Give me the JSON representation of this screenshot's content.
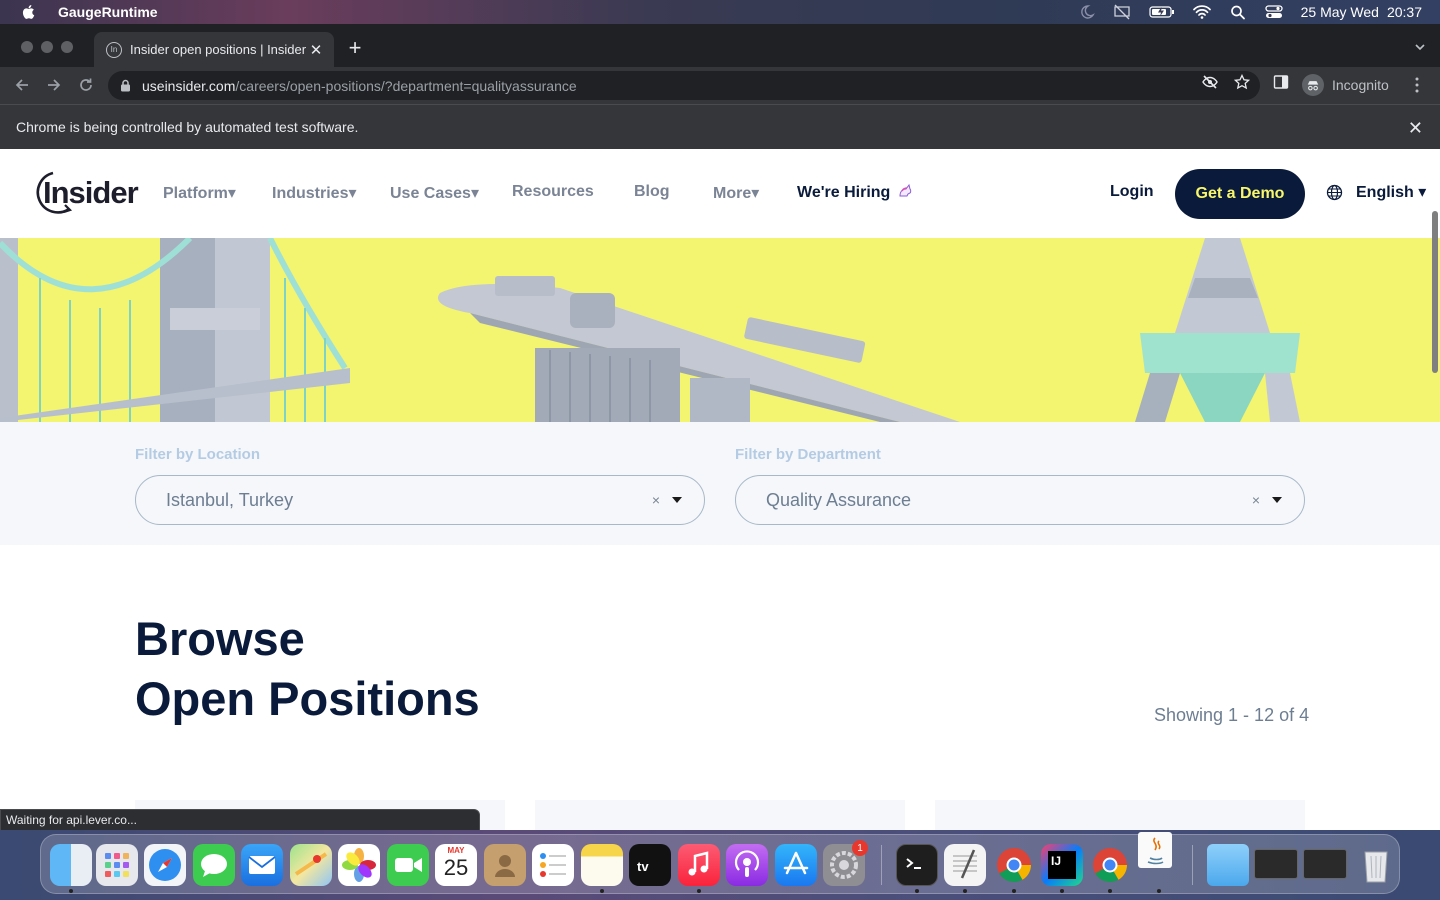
{
  "menubar": {
    "app_name": "GaugeRuntime",
    "date": "25 May Wed",
    "time": "20:37"
  },
  "browser": {
    "tab_title": "Insider open positions | Insider",
    "favicon_letters": "In",
    "url_host": "useinsider.com",
    "url_path": "/careers/open-positions/?department=qualityassurance",
    "profile_label": "Incognito",
    "infobar_message": "Chrome is being controlled by automated test software.",
    "status_text": "Waiting for api.lever.co..."
  },
  "site": {
    "logo_text": "Insider",
    "nav": [
      {
        "label": "Platform▾"
      },
      {
        "label": "Industries▾"
      },
      {
        "label": "Use Cases▾"
      },
      {
        "label": "Resources"
      },
      {
        "label": "Blog"
      },
      {
        "label": "More▾"
      },
      {
        "label": "We're Hiring"
      }
    ],
    "login_label": "Login",
    "demo_label": "Get a Demo",
    "language_label": "English ▾"
  },
  "filters": {
    "location_label": "Filter by Location",
    "location_value": "Istanbul, Turkey",
    "department_label": "Filter by Department",
    "department_value": "Quality Assurance",
    "clear_symbol": "×"
  },
  "listing": {
    "heading_line1": "Browse",
    "heading_line2": "Open Positions",
    "showing_text": "Showing 1 - 12 of 4"
  },
  "dock": {
    "calendar_month": "MAY",
    "calendar_day": "25",
    "settings_badge": "1",
    "apps": [
      "finder-icon",
      "launchpad-icon",
      "safari-icon",
      "messages-icon",
      "mail-icon",
      "maps-icon",
      "photos-icon",
      "facetime-icon",
      "calendar-icon",
      "contacts-icon",
      "reminders-icon",
      "notes-icon",
      "apple-tv-icon",
      "music-icon",
      "podcasts-icon",
      "app-store-icon",
      "system-preferences-icon",
      "terminal-icon",
      "textedit-icon",
      "chrome-icon",
      "intellij-icon",
      "chrome-icon",
      "java-icon",
      "downloads-folder-icon",
      "window-thumbnail-icon",
      "window-thumbnail-icon",
      "trash-icon"
    ]
  },
  "colors": {
    "navy": "#0a1a3a",
    "demo_text": "#f8f66b",
    "hero_yellow": "#f3f46f",
    "filter_label": "#b4cbe4"
  }
}
